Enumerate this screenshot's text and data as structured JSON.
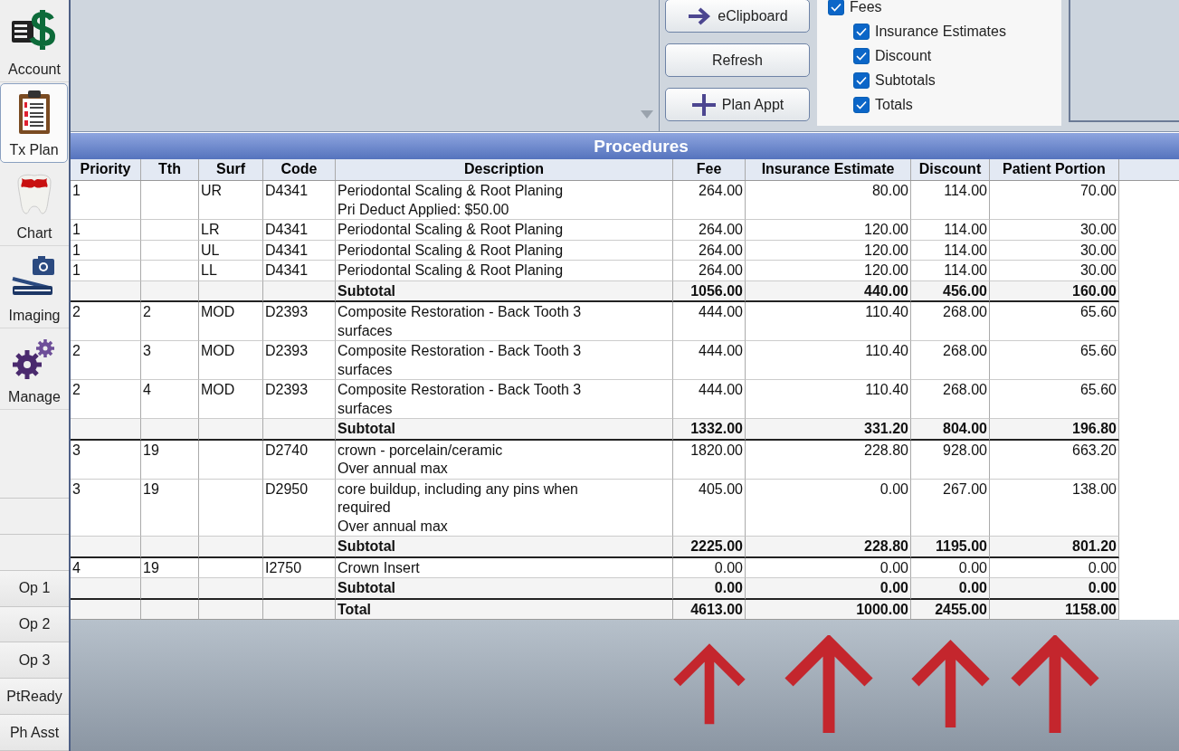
{
  "sidebar": {
    "modules": [
      {
        "kind": "account",
        "label": "Account",
        "selected": false
      },
      {
        "kind": "txplan",
        "label": "Tx Plan",
        "selected": true
      },
      {
        "kind": "chart",
        "label": "Chart",
        "selected": false
      },
      {
        "kind": "imaging",
        "label": "Imaging",
        "selected": false
      },
      {
        "kind": "manage",
        "label": "Manage",
        "selected": false
      }
    ],
    "operatories": [
      "Op 1",
      "Op 2",
      "Op 3",
      "PtReady",
      "Ph Asst"
    ]
  },
  "buttons": [
    {
      "kind": "arrow",
      "label": "eClipboard"
    },
    {
      "kind": "plain",
      "label": "Refresh"
    },
    {
      "kind": "plus",
      "label": "Plan Appt"
    }
  ],
  "display_options": [
    {
      "label": "Fees",
      "checked": true,
      "children": [
        {
          "label": "Insurance Estimates",
          "checked": true
        },
        {
          "label": "Discount",
          "checked": true
        },
        {
          "label": "Subtotals",
          "checked": true
        },
        {
          "label": "Totals",
          "checked": true
        }
      ]
    }
  ],
  "procedures": {
    "title": "Procedures",
    "columns": [
      {
        "label": "Priority",
        "kind": "text",
        "arrow_below": false
      },
      {
        "label": "Tth",
        "kind": "text",
        "arrow_below": false
      },
      {
        "label": "Surf",
        "kind": "text",
        "arrow_below": false
      },
      {
        "label": "Code",
        "kind": "text",
        "arrow_below": false
      },
      {
        "label": "Description",
        "kind": "text",
        "arrow_below": false
      },
      {
        "label": "Fee",
        "kind": "amount",
        "arrow_below": true
      },
      {
        "label": "Insurance Estimate",
        "kind": "amount",
        "arrow_below": true
      },
      {
        "label": "Discount",
        "kind": "amount",
        "arrow_below": true
      },
      {
        "label": "Patient Portion",
        "kind": "amount",
        "arrow_below": true
      }
    ],
    "rows": [
      {
        "kind": "item",
        "cells": [
          "1",
          "",
          "UR",
          "D4341",
          "Periodontal Scaling & Root Planing",
          "264.00",
          "80.00",
          "114.00",
          "70.00"
        ],
        "note": "Pri Deduct Applied: $50.00"
      },
      {
        "kind": "item",
        "cells": [
          "1",
          "",
          "LR",
          "D4341",
          "Periodontal Scaling & Root Planing",
          "264.00",
          "120.00",
          "114.00",
          "30.00"
        ]
      },
      {
        "kind": "item",
        "cells": [
          "1",
          "",
          "UL",
          "D4341",
          "Periodontal Scaling & Root Planing",
          "264.00",
          "120.00",
          "114.00",
          "30.00"
        ]
      },
      {
        "kind": "item",
        "cells": [
          "1",
          "",
          "LL",
          "D4341",
          "Periodontal Scaling & Root Planing",
          "264.00",
          "120.00",
          "114.00",
          "30.00"
        ]
      },
      {
        "kind": "subtotal",
        "cells": [
          "",
          "",
          "",
          "",
          "Subtotal",
          "1056.00",
          "440.00",
          "456.00",
          "160.00"
        ]
      },
      {
        "kind": "item",
        "cells": [
          "2",
          "2",
          "MOD",
          "D2393",
          "Composite Restoration - Back Tooth 3 surfaces",
          "444.00",
          "110.40",
          "268.00",
          "65.60"
        ]
      },
      {
        "kind": "item",
        "cells": [
          "2",
          "3",
          "MOD",
          "D2393",
          "Composite Restoration - Back Tooth 3 surfaces",
          "444.00",
          "110.40",
          "268.00",
          "65.60"
        ]
      },
      {
        "kind": "item",
        "cells": [
          "2",
          "4",
          "MOD",
          "D2393",
          "Composite Restoration - Back Tooth 3 surfaces",
          "444.00",
          "110.40",
          "268.00",
          "65.60"
        ]
      },
      {
        "kind": "subtotal",
        "cells": [
          "",
          "",
          "",
          "",
          "Subtotal",
          "1332.00",
          "331.20",
          "804.00",
          "196.80"
        ]
      },
      {
        "kind": "item",
        "cells": [
          "3",
          "19",
          "",
          "D2740",
          "crown - porcelain/ceramic",
          "1820.00",
          "228.80",
          "928.00",
          "663.20"
        ],
        "note": "Over annual max"
      },
      {
        "kind": "item",
        "cells": [
          "3",
          "19",
          "",
          "D2950",
          "core buildup, including any pins when required",
          "405.00",
          "0.00",
          "267.00",
          "138.00"
        ],
        "note": "Over annual max"
      },
      {
        "kind": "subtotal",
        "cells": [
          "",
          "",
          "",
          "",
          "Subtotal",
          "2225.00",
          "228.80",
          "1195.00",
          "801.20"
        ]
      },
      {
        "kind": "item",
        "cells": [
          "4",
          "19",
          "",
          "I2750",
          "Crown Insert",
          "0.00",
          "0.00",
          "0.00",
          "0.00"
        ]
      },
      {
        "kind": "subtotal",
        "cells": [
          "",
          "",
          "",
          "",
          "Subtotal",
          "0.00",
          "0.00",
          "0.00",
          "0.00"
        ]
      },
      {
        "kind": "total",
        "cells": [
          "",
          "",
          "",
          "",
          "Total",
          "4613.00",
          "1000.00",
          "2455.00",
          "1158.00"
        ]
      }
    ]
  }
}
